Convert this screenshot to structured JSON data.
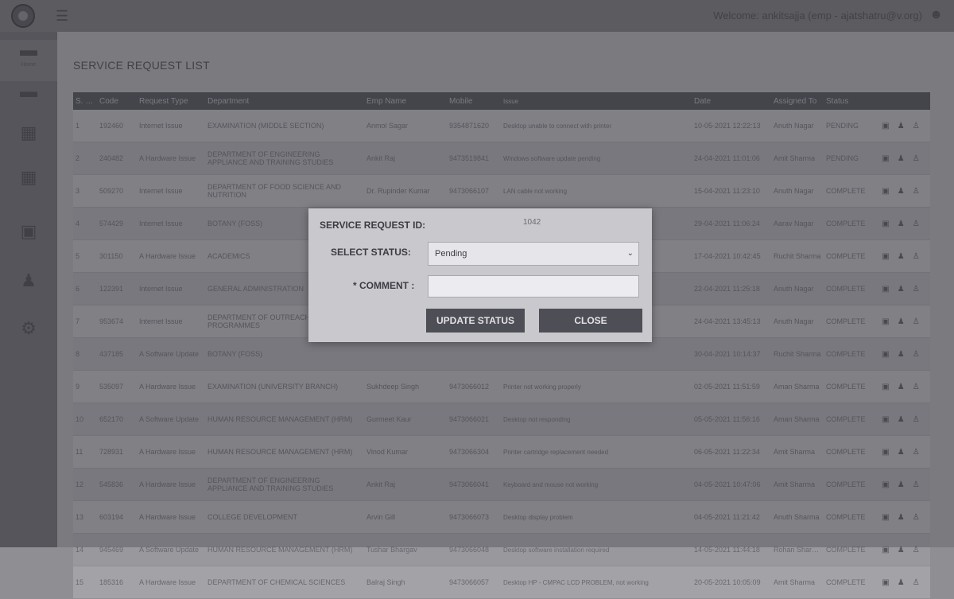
{
  "topbar": {
    "welcome": "Welcome: ankitsajja (emp - ajatshatru@v.org)",
    "icons": [
      "app-logo-icon",
      "menu-icon",
      "user-icon"
    ]
  },
  "sidebar": {
    "items": [
      {
        "label": "Home",
        "icon": "folder-icon"
      },
      {
        "label": "",
        "icon": "folder-icon"
      },
      {
        "label": "",
        "icon": "calendar-icon"
      },
      {
        "label": "",
        "icon": "calendar-icon"
      },
      {
        "label": "",
        "icon": "document-icon"
      },
      {
        "label": "",
        "icon": "users-icon"
      },
      {
        "label": "",
        "icon": "gear-icon"
      }
    ]
  },
  "main": {
    "title": "SERVICE REQUEST LIST",
    "columns": [
      "S. No.",
      "Code",
      "Request Type",
      "Department",
      "Emp Name",
      "Mobile",
      "Issue",
      "",
      "Date",
      "Assigned To",
      "Status",
      "",
      "",
      ""
    ],
    "rows": [
      [
        "1",
        "192460",
        "Internet Issue",
        "EXAMINATION (MIDDLE SECTION)",
        "Anmol Sagar",
        "9354871620",
        "Desktop unable to connect with printer",
        "",
        "10-05-2021 12:22:13",
        "Anuth Nagar",
        "PENDING"
      ],
      [
        "2",
        "240482",
        "A Hardware Issue",
        "DEPARTMENT OF ENGINEERING APPLIANCE AND TRAINING STUDIES",
        "Ankit Raj",
        "9473519841",
        "Windows software update pending",
        "",
        "24-04-2021 11:01:06",
        "Amit Sharma",
        "PENDING"
      ],
      [
        "3",
        "509270",
        "Internet Issue",
        "DEPARTMENT OF FOOD SCIENCE AND NUTRITION",
        "Dr. Rupinder Kumar",
        "9473066107",
        "LAN cable not working",
        "",
        "15-04-2021 11:23:10",
        "Anuth Nagar",
        "COMPLETE"
      ],
      [
        "4",
        "574429",
        "Internet Issue",
        "BOTANY (FOSS)",
        "",
        "",
        "",
        "",
        "29-04-2021 11:06:24",
        "Aarav Nagar",
        "COMPLETE"
      ],
      [
        "5",
        "301150",
        "A Hardware Issue",
        "ACADEMICS",
        "",
        "",
        "",
        "",
        "17-04-2021 10:42:45",
        "Ruchit Sharma",
        "COMPLETE"
      ],
      [
        "6",
        "122391",
        "Internet Issue",
        "GENERAL ADMINISTRATION",
        "",
        "",
        "",
        "",
        "22-04-2021 11:25:18",
        "Anuth Nagar",
        "COMPLETE"
      ],
      [
        "7",
        "953674",
        "Internet Issue",
        "DEPARTMENT OF OUTREACH PROGRAMMES",
        "",
        "",
        "",
        "",
        "24-04-2021 13:45:13",
        "Anuth Nagar",
        "COMPLETE"
      ],
      [
        "8",
        "437185",
        "A Software Update",
        "BOTANY (FOSS)",
        "",
        "",
        "",
        "",
        "30-04-2021 10:14:37",
        "Ruchit Sharma",
        "COMPLETE"
      ],
      [
        "9",
        "535097",
        "A Hardware Issue",
        "EXAMINATION (UNIVERSITY BRANCH)",
        "Sukhdeep Singh",
        "9473066012",
        "Printer not working properly",
        "",
        "02-05-2021 11:51:59",
        "Aman Sharma",
        "COMPLETE"
      ],
      [
        "10",
        "652170",
        "A Software Update",
        "HUMAN RESOURCE MANAGEMENT (HRM)",
        "Gurmeet Kaur",
        "9473066021",
        "Desktop not responding",
        "",
        "05-05-2021 11:56:16",
        "Aman Sharma",
        "COMPLETE"
      ],
      [
        "11",
        "728931",
        "A Hardware Issue",
        "HUMAN RESOURCE MANAGEMENT (HRM)",
        "Vinod Kumar",
        "9473066304",
        "Printer cartridge replacement needed",
        "",
        "06-05-2021 11:22:34",
        "Amit Sharma",
        "COMPLETE"
      ],
      [
        "12",
        "545836",
        "A Hardware Issue",
        "DEPARTMENT OF ENGINEERING APPLIANCE AND TRAINING STUDIES",
        "Ankit Raj",
        "9473066041",
        "Keyboard and mouse not working",
        "",
        "04-05-2021 10:47:06",
        "Amit Sharma",
        "COMPLETE"
      ],
      [
        "13",
        "603194",
        "A Hardware Issue",
        "COLLEGE DEVELOPMENT",
        "Arvin Gill",
        "9473066073",
        "Desktop display problem",
        "",
        "04-05-2021 11:21:42",
        "Anuth Sharma",
        "COMPLETE"
      ],
      [
        "14",
        "945469",
        "A Software Update",
        "HUMAN RESOURCE MANAGEMENT (HRM)",
        "Tushar Bhargav",
        "9473066048",
        "Desktop software installation required",
        "",
        "14-05-2021 11:44:18",
        "Rohan Sharma",
        "COMPLETE"
      ],
      [
        "15",
        "185316",
        "A Hardware Issue",
        "DEPARTMENT OF CHEMICAL SCIENCES",
        "Balraj Singh",
        "9473066057",
        "Desktop HP - CMPAC LCD PROBLEM, not working",
        "",
        "20-05-2021 10:05:09",
        "Amit Sharma",
        "COMPLETE"
      ]
    ]
  },
  "modal": {
    "request_id_label": "SERVICE REQUEST ID:",
    "request_id_value": "1042",
    "status_label": "SELECT STATUS:",
    "status_value": "Pending",
    "comment_label": "* COMMENT :",
    "comment_value": "",
    "update_button": "UPDATE STATUS",
    "close_button": "CLOSE"
  }
}
